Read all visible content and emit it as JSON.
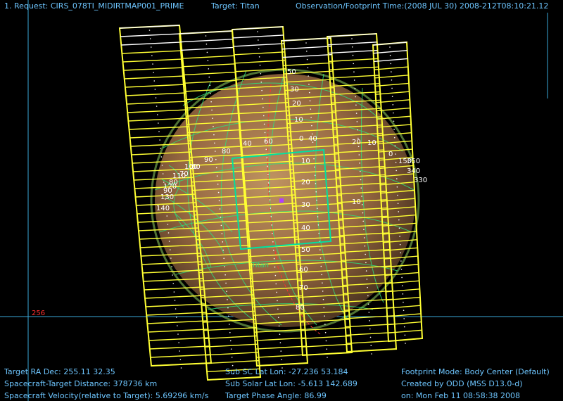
{
  "header": {
    "request": "1. Request: CIRS_078TI_MIDIRTMAP001_PRIME",
    "target": "Target: Titan",
    "obs_time": "Observation/Footprint Time:(2008 JUL 30) 2008-212T08:10:21.12"
  },
  "footer": {
    "ra_dec": "Target RA Dec: 255.11  32.35",
    "distance": "Spacecraft-Target Distance:  378736 km",
    "velocity": "Spacecraft Velocity(relative to Target): 5.69296 km/s",
    "sub_sc": "Sub SC Lat Lon: -27.236  53.184",
    "sub_solar": "Sub Solar Lat Lon: -5.613  142.689",
    "phase": "Target Phase Angle: 86.99",
    "mode": "Footprint Mode: Body Center (Default)",
    "created_by": "Created by ODD (MSS D13.0-d)",
    "created_on": "on: Mon Feb 11 08:58:38 2008"
  },
  "labels": {
    "target_name": "Titan",
    "ref_line": "256",
    "lat_lon": [
      "80",
      "60",
      "40",
      "40",
      "30",
      "20",
      "10",
      "10",
      "20",
      "30",
      "40",
      "50",
      "60",
      "70",
      "80",
      "0",
      "20",
      "90",
      "0",
      "50",
      "60",
      "70",
      "80",
      "90",
      "100",
      "110",
      "120",
      "130",
      "140",
      "150",
      "340",
      "350",
      "330",
      "10",
      "10"
    ]
  },
  "colors": {
    "footprint": "#ffff33",
    "footprint_highlight": "#ffffff",
    "fov": "#00e0a0",
    "grid": "#2ee07a",
    "axis": "#3aa9d9",
    "text": "#6ec6ff"
  }
}
